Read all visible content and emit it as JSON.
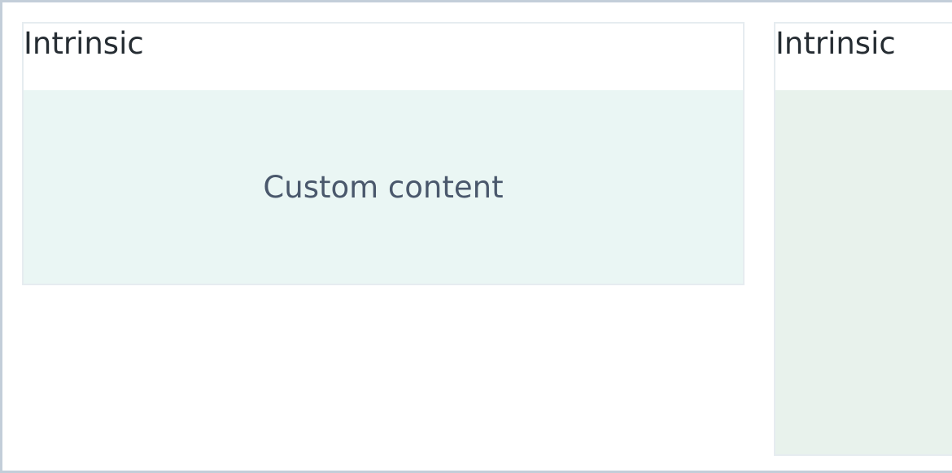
{
  "cards": [
    {
      "title": "Intrinsic",
      "content": "Custom content"
    },
    {
      "title": "Intrinsic",
      "content": ""
    }
  ]
}
